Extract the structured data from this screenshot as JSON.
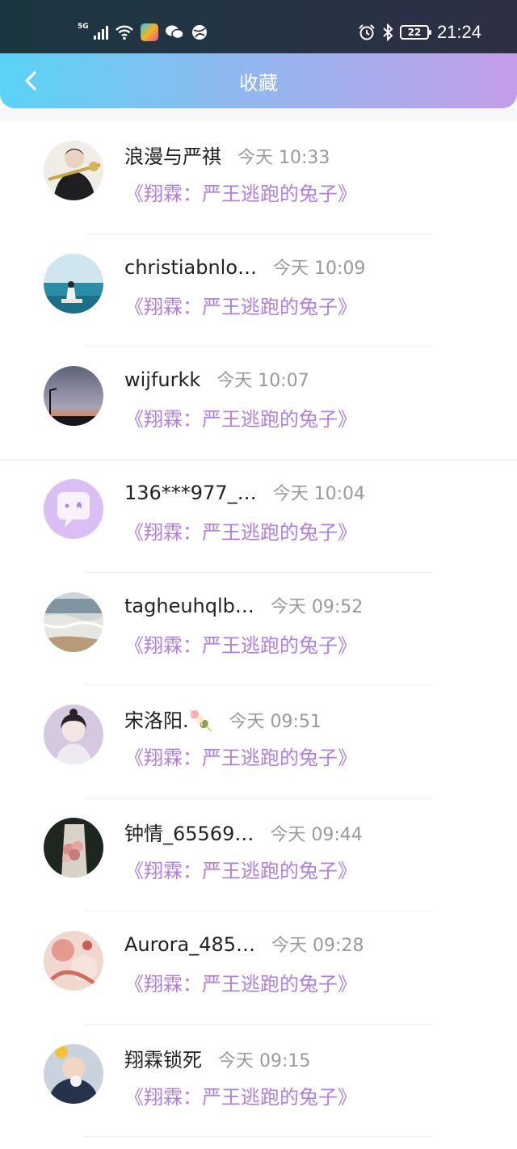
{
  "status_bar": {
    "network": "5G",
    "battery": "22",
    "time": "21:24",
    "icons": [
      "signal-icon",
      "wifi-icon",
      "app-icon",
      "wechat-icon",
      "browser-icon",
      "alarm-icon",
      "bluetooth-icon",
      "battery-icon"
    ]
  },
  "header": {
    "title": "收藏",
    "back_icon": "chevron-left-icon",
    "gradient": [
      "#5bd3f6",
      "#94b6ef",
      "#c49ee8"
    ]
  },
  "accent_color": "#b07fe0",
  "items": [
    {
      "name": "浪漫与严祺",
      "time": "今天 10:33",
      "book": "《翔霖：严王逃跑的兔子》",
      "avatar": "portrait"
    },
    {
      "name": "christiabnlo…",
      "time": "今天 10:09",
      "book": "《翔霖：严王逃跑的兔子》",
      "avatar": "sea"
    },
    {
      "name": "wijfurkk",
      "time": "今天 10:07",
      "book": "《翔霖：严王逃跑的兔子》",
      "avatar": "dusk"
    },
    {
      "name": "136***977_…",
      "time": "今天 10:04",
      "book": "《翔霖：严王逃跑的兔子》",
      "avatar": "default"
    },
    {
      "name": "tagheuhqlb…",
      "time": "今天 09:52",
      "book": "《翔霖：严王逃跑的兔子》",
      "avatar": "beach"
    },
    {
      "name": "宋洛阳.🍡",
      "time": "今天 09:51",
      "book": "《翔霖：严王逃跑的兔子》",
      "avatar": "girl"
    },
    {
      "name": "钟情_65569…",
      "time": "今天 09:44",
      "book": "《翔霖：严王逃跑的兔子》",
      "avatar": "flowers"
    },
    {
      "name": "Aurora_485…",
      "time": "今天 09:28",
      "book": "《翔霖：严王逃跑的兔子》",
      "avatar": "painting"
    },
    {
      "name": "翔霖锁死",
      "time": "今天 09:15",
      "book": "《翔霖：严王逃跑的兔子》",
      "avatar": "child"
    }
  ]
}
